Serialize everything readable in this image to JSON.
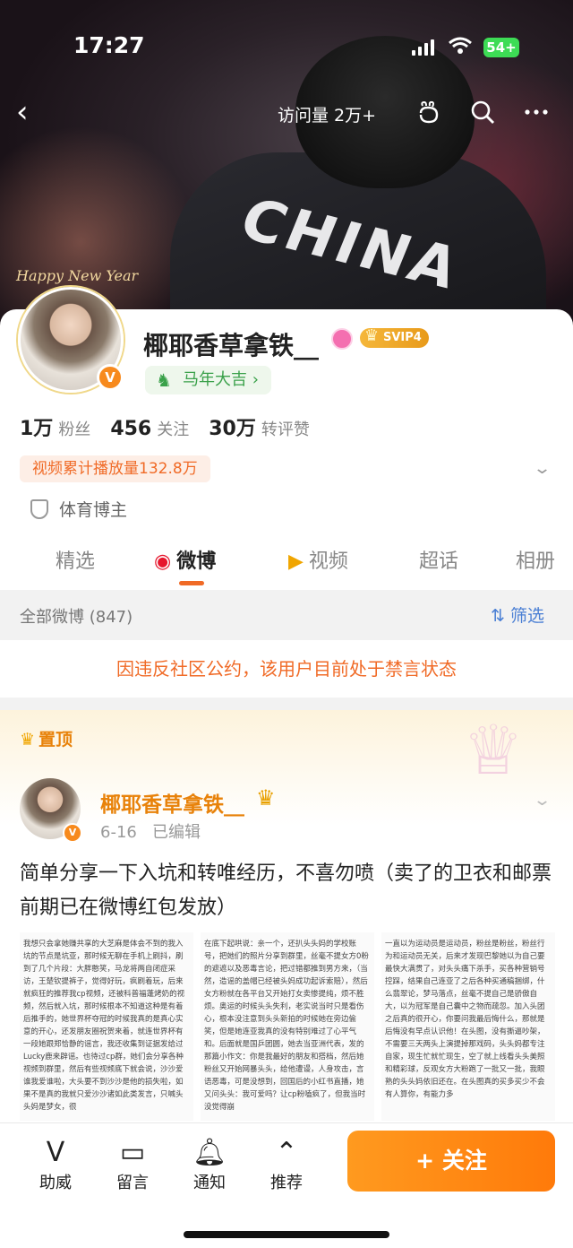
{
  "status": {
    "time": "17:27",
    "battery": "54+"
  },
  "nav": {
    "visits": "访问量 2万+",
    "back_icon": "back-arrow-icon",
    "icons": [
      "emoji-icon",
      "search-icon",
      "more-icon"
    ]
  },
  "banner": {
    "jersey_text": "CHINA",
    "greeting": "Happy New Year"
  },
  "profile": {
    "name": "椰耶香草拿铁__",
    "svip": "SVIP4",
    "tag": "马年大吉",
    "stats": [
      {
        "value": "1万",
        "label": "粉丝"
      },
      {
        "value": "456",
        "label": "关注"
      },
      {
        "value": "30万",
        "label": "转评赞"
      }
    ],
    "play_count": "视频累计播放量132.8万",
    "category": "体育博主"
  },
  "tabs": [
    {
      "label": "精选"
    },
    {
      "label": "微博"
    },
    {
      "label": "视频"
    },
    {
      "label": "超话"
    },
    {
      "label": "相册"
    }
  ],
  "feed_header": {
    "all": "全部微博 (847)",
    "filter": "筛选"
  },
  "ban_notice": "因违反社区公约，该用户目前处于禁言状态",
  "post": {
    "pinned": "置顶",
    "author": "椰耶香草拿铁__",
    "date": "6-16",
    "edited": "已编辑",
    "text": "简单分享一下入坑和转唯经历，不喜勿喷（卖了的卫衣和邮票前期已在微博红包发放）",
    "thumbs": [
      "我想只会拿她赚共享的大芝麻是体会不到的我入坑的节点是坑亚，那时候无聊在手机上刷抖，刷到了几个片段：大胖憨笑，马龙将两自闭症采访，王楚钦提裤子，觉得好玩，疯刷着玩，后来就疯狂的推荐我cp视频，还被科普福蓬烤奶的视频，然后就入坑，那时候根本不知道这种是有着后推手的，她世界杯夺冠的时候我真的是真心实意的开心，还发朋友圈祝贺来着，就连世界杯有一段她跟郑恰静的谣言，我还收集到证据发给过Lucky鹿来辟谣。也待过cp群，她们会分享各种视频到群里，然后有些视频底下就会说，沙沙爱谁我爱谁啦，大头要不到沙沙是他的损失啦，如果不是真的我就只爱沙沙诸如此类发言，只喊头头妈是梦女，很",
      "在底下起哄说：亲一个，还扒头头妈的学校账号，把她们的照片分享到群里，丝毫不提女方0粉的遮遮以及恶毒言论，把过错都推到男方来，（当然，造谣的盖帽已经被头妈成功起诉索赔），然后女方粉就在各平台又开始打女卖惨提纯，烦不胜烦。奥运的时候头头失利，老实说当时只是看伤心，根本没注意到头头新拍的时候她在旁边偷笑，但是她连亚我真的没有特别难过了心平气和。后面就是国乒团圆，她去当亚洲代表，发的那篇小作文：你是我最好的朋友和搭档，然后她粉丝又开始网暴头头，给他遭谩，人身攻击，言语恶毒，可是没想到，回国后的小红书直播，她又问头头：我可爱吗？让cp粉嗑疯了，但我当时没觉得崩",
      "一直以为运动员是运动员，粉丝是粉丝，粉丝行为和运动员无关，后来才发现巴黎她以为自己要最快大满贯了，对头头痛下杀手，买各种营销号控踩，结果自己连亚了之后各种买通稿捆绑，什么翡翠论，梦马落点，丝毫不提自己是骄傲自大，以为冠军是自己囊中之物而疏忽。加入头团之后真的很开心，你要问我最后悔什么，那就是后悔没有早点认识他！在头图，没有撕逼吵架，不需要三天两头上演提掉那戏码，头头妈都专注自家，现生忙就忙现生，空了就上线看头头美照和精彩球，反观女方大粉跑了一批又一批，我眼熟的头头妈依旧还在。在头图真的买多买少不会有人算你，有能力多"
    ]
  },
  "bottom": {
    "items": [
      {
        "label": "助威",
        "icon": "cheer-icon"
      },
      {
        "label": "留言",
        "icon": "comment-icon"
      },
      {
        "label": "通知",
        "icon": "bell-icon"
      },
      {
        "label": "推荐",
        "icon": "recommend-icon"
      }
    ],
    "follow": "+ 关注"
  },
  "colors": {
    "accent": "#f06a26",
    "follow": "#ff8a14",
    "link": "#4a7fd4",
    "tag_green": "#3aa14a"
  }
}
